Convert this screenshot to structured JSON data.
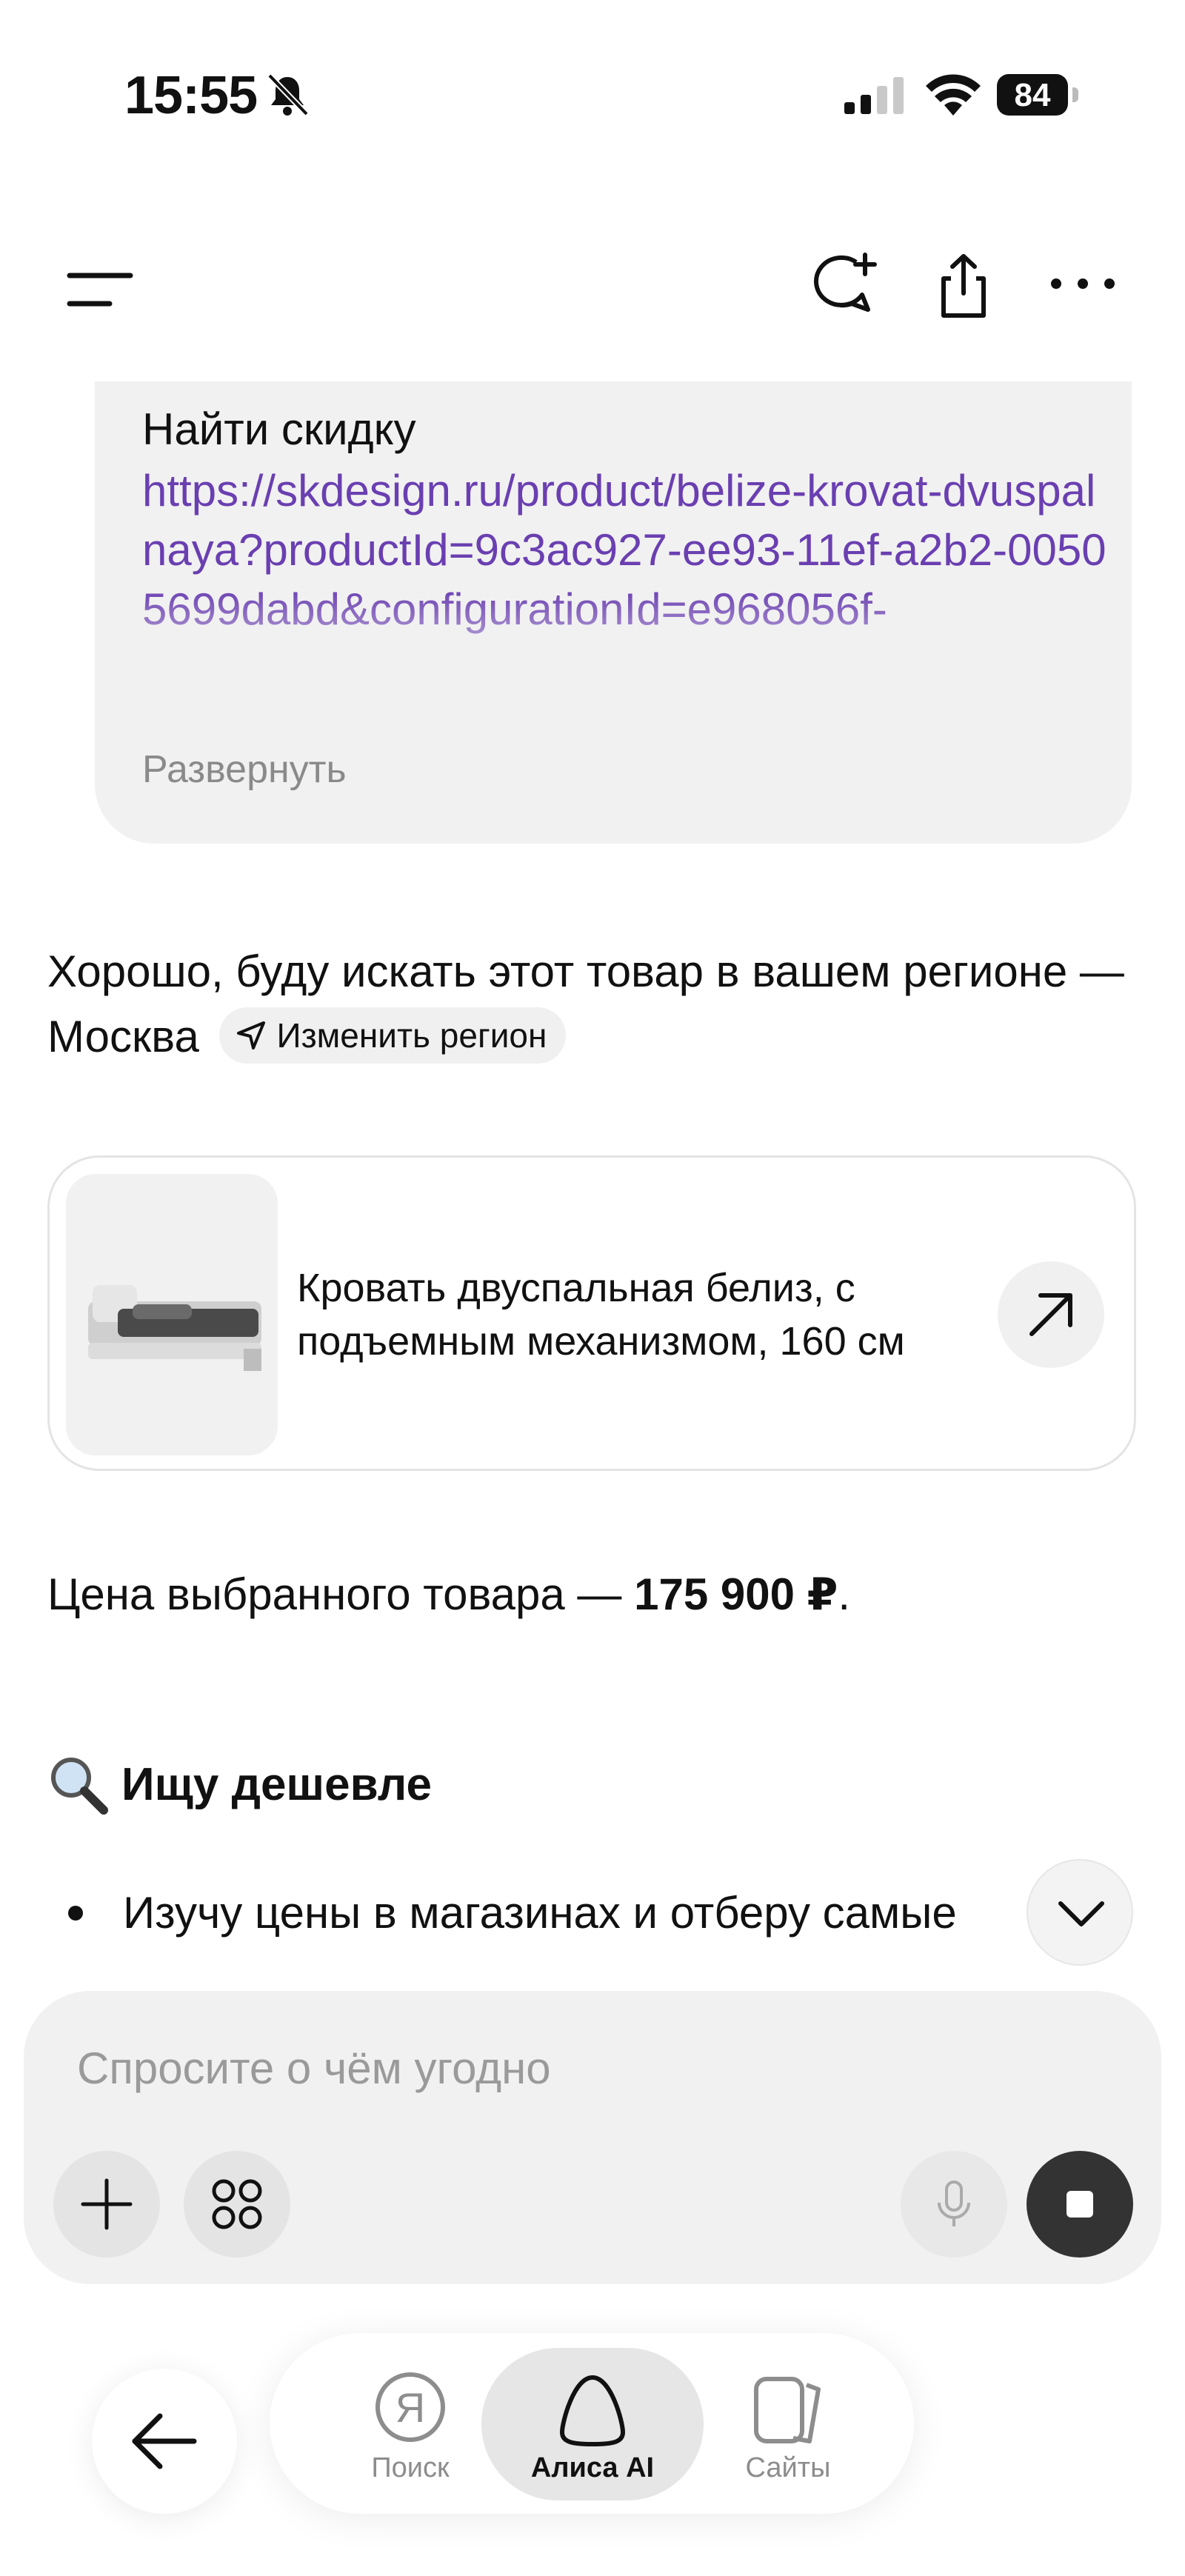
{
  "status_bar": {
    "time": "15:55",
    "battery": "84"
  },
  "user_message": {
    "title": "Найти скидку",
    "link": "https://skdesign.ru/product/belize-krovat-dvuspalnaya?productId=9c3ac927-ee93-11ef-a2b2-00505699dabd&configurationId=e968056f-",
    "expand_label": "Развернуть"
  },
  "assistant": {
    "reply_text": "Хорошо, буду искать этот товар в вашем регионе — Москва",
    "region_chip": "Изменить регион",
    "product": {
      "name": "Кровать двуспальная белиз, с подъемным механизмом, 160 см"
    },
    "price_prefix": "Цена выбранного товара — ",
    "price_value": "175 900 ₽",
    "price_suffix": ".",
    "search_heading": "Ищу дешевле",
    "bullet": "Изучу цены в магазинах и отберу самые"
  },
  "input": {
    "placeholder": "Спросите о чём угодно"
  },
  "bottom_nav": {
    "items": [
      {
        "label": "Поиск",
        "icon": "yandex-search-icon"
      },
      {
        "label": "Алиса AI",
        "icon": "alice-icon",
        "active": true
      },
      {
        "label": "Сайты",
        "icon": "sites-icon"
      }
    ]
  },
  "colors": {
    "link": "#6a3fb1",
    "bubble": "#f1f1f1",
    "stop_button": "#333333"
  }
}
